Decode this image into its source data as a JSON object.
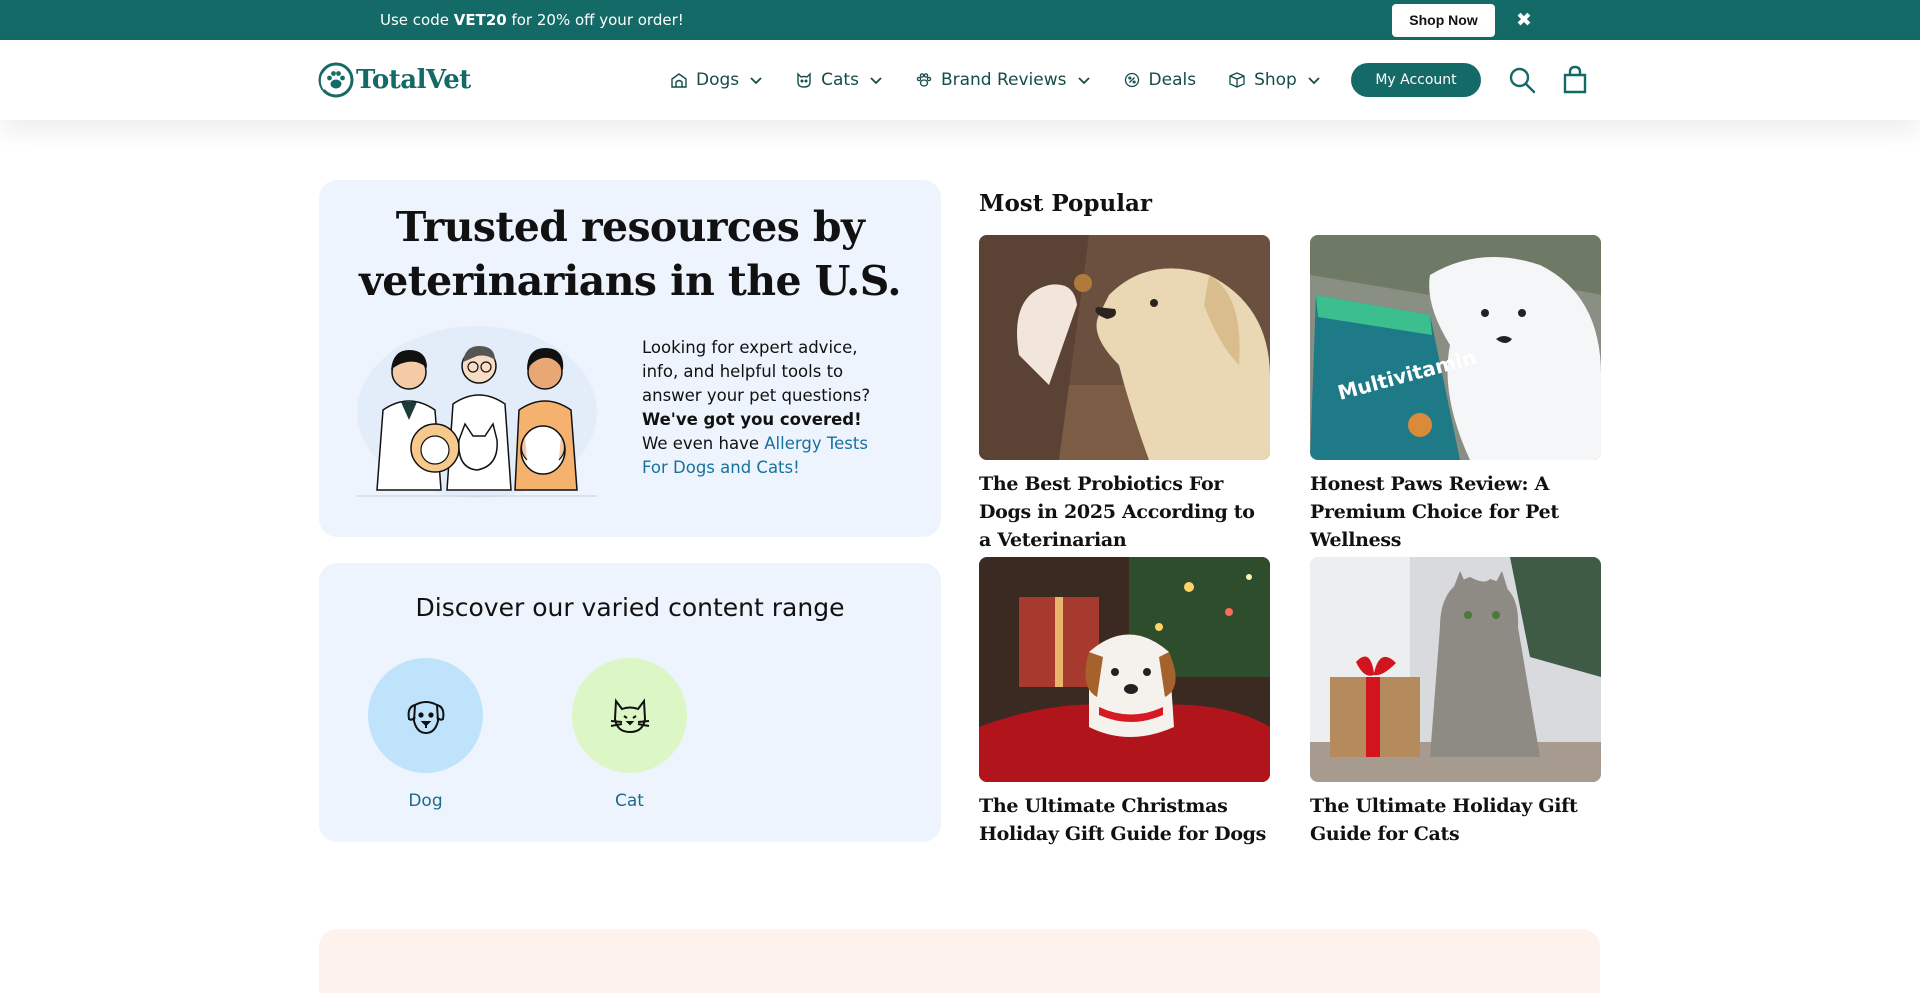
{
  "promo": {
    "text_before": "Use code ",
    "code": "VET20",
    "text_after": " for 20% off your order!",
    "shop_label": "Shop Now",
    "close_glyph": "✖"
  },
  "header": {
    "logo_text": "TotalVet",
    "nav": [
      {
        "label": "Dogs",
        "icon": "dog-house-icon",
        "has_dropdown": true
      },
      {
        "label": "Cats",
        "icon": "cat-face-icon",
        "has_dropdown": true
      },
      {
        "label": "Brand Reviews",
        "icon": "paw-icon",
        "has_dropdown": true
      },
      {
        "label": "Deals",
        "icon": "tag-icon",
        "has_dropdown": false
      },
      {
        "label": "Shop",
        "icon": "box-icon",
        "has_dropdown": true
      }
    ],
    "account_label": "My Account"
  },
  "hero": {
    "title_line1": "Trusted resources by",
    "title_line2": "veterinarians in the U.S.",
    "text_1": "Looking for expert advice, info, and helpful tools to answer your pet questions? ",
    "text_bold": "We've got you covered!",
    "text_2": " We even have ",
    "link": "Allergy Tests For Dogs and Cats!"
  },
  "discover": {
    "title": "Discover our varied content range",
    "categories": [
      {
        "label": "Dog",
        "color": "#bfe3fb",
        "icon": "dog-icon"
      },
      {
        "label": "Cat",
        "color": "#dcf6c6",
        "icon": "cat-icon"
      }
    ]
  },
  "popular": {
    "title": "Most Popular",
    "articles": [
      {
        "title": "The Best Probiotics For Dogs in 2025 According to a Veterinarian",
        "image": "golden-retriever-treat-photo"
      },
      {
        "title": "Honest Paws Review: A Premium Choice for Pet Wellness",
        "image": "samoyed-multivitamin-photo"
      },
      {
        "title": "The Ultimate Christmas Holiday Gift Guide for Dogs",
        "image": "puppy-christmas-photo"
      },
      {
        "title": "The Ultimate Holiday Gift Guide for Cats",
        "image": "cat-gift-photo"
      }
    ]
  },
  "colors": {
    "brand": "#146a67",
    "card_bg": "#eef4fd",
    "link": "#17719e",
    "peach": "#fdf2ec"
  }
}
